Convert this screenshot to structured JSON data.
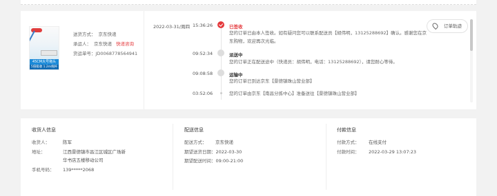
{
  "order": {
    "shipping_method_label": "送货方式：",
    "shipping_method": "京东快递",
    "carrier_label": "承运人：",
    "carrier": "京东快递",
    "carrier_link": "快递咨询",
    "tracking_label": "货运单号：",
    "tracking_number": "JD0068778564941",
    "product_tag1": "45CM大号拖头",
    "product_tag2": "5倍吸收 1.2m拖杆"
  },
  "track_button": "订单轨迹",
  "timeline": [
    {
      "date": "2022-03-31/周四",
      "time": "15:36:26",
      "title": "已签收",
      "lines": [
        "您的订单已由本人签收。如有疑问您可以联系配送员【胡伟明，13125288692】确认。感谢您在京",
        "东购物，欢迎再次光临。"
      ]
    },
    {
      "date": "",
      "time": "09:52:34",
      "title": "派送中",
      "lines": [
        "您的订单正在配送途中（快递员：胡伟明，电话：13125288692），请您耐心等待。"
      ]
    },
    {
      "date": "",
      "time": "09:08:58",
      "title": "运输中",
      "lines": [
        "您的订单已到达京东【景德镇珠山营业部】"
      ]
    },
    {
      "date": "",
      "time": "03:52:06",
      "title": "",
      "lines": [
        "您的订单由京东【南昌分拣中心】准备送往【景德镇珠山营业部】"
      ]
    }
  ],
  "receiver": {
    "title": "收货人信息",
    "name_label": "收货人：",
    "name": "陈军",
    "address_label": "地址：",
    "address_line1": "江西景德镇市昌江区城区广场新",
    "address_line2": "华书店五楼移动公司",
    "phone_label": "手机号码：",
    "phone": "139*****2068"
  },
  "delivery": {
    "title": "配送信息",
    "method_label": "配送方式：",
    "method": "京东快递",
    "date_label": "期望送货日期：",
    "date": "2022-03-30",
    "time_label": "期望配送时间：",
    "time": "09:00-21:00"
  },
  "payment": {
    "title": "付款信息",
    "method_label": "付款方式：",
    "method": "在线支付",
    "time_label": "付款时间：",
    "time": "2022-03-29 13:07:23"
  },
  "colors": {
    "accent": "#e4393c",
    "background": "#f2f2f2"
  }
}
